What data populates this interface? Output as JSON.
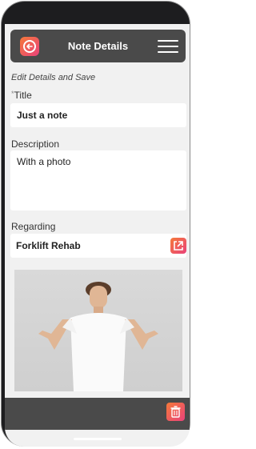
{
  "header": {
    "title": "Note Details",
    "back_icon": "back-arrow-icon",
    "menu_icon": "hamburger-menu-icon"
  },
  "form": {
    "section_label": "Edit Details and Save",
    "title": {
      "required_mark": "*",
      "label": "Title",
      "value": "Just a note"
    },
    "description": {
      "label": "Description",
      "value": "With a photo"
    },
    "regarding": {
      "label": "Regarding",
      "value": "Forklift Rehab",
      "link_icon": "open-external-icon"
    }
  },
  "footer": {
    "trash_icon": "trash-icon"
  },
  "colors": {
    "accent_start": "#f5793a",
    "accent_end": "#e9427a",
    "header_bg": "#4a4a4a",
    "screen_bg": "#f1f1f1"
  }
}
